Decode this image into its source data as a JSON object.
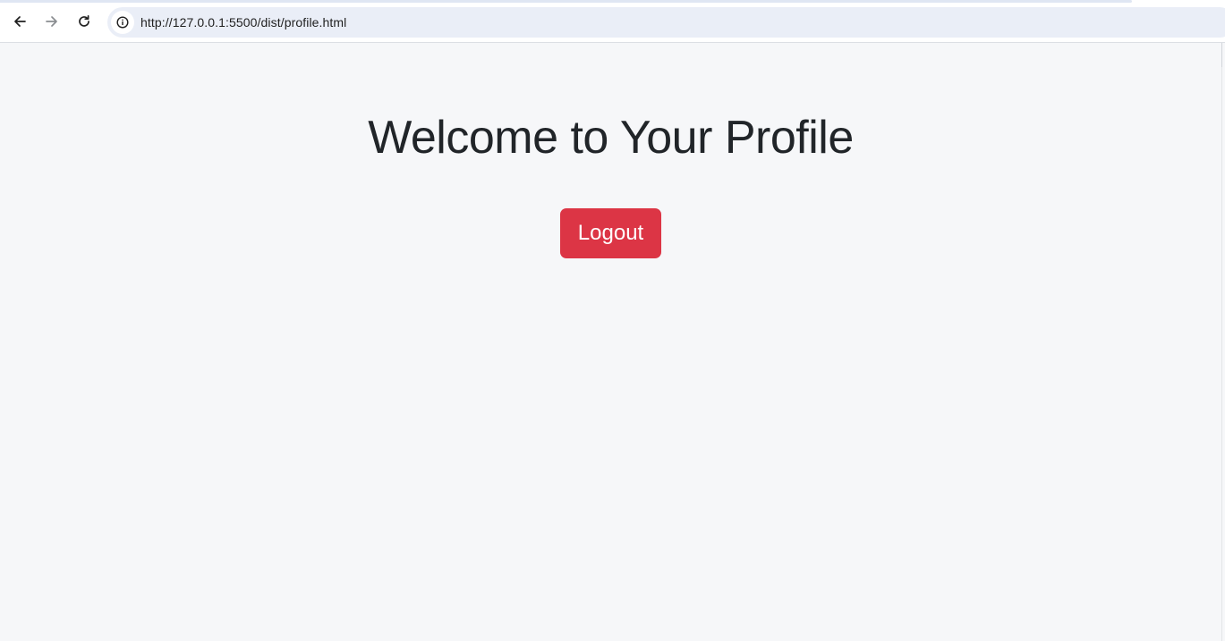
{
  "browser": {
    "url": "http://127.0.0.1:5500/dist/profile.html",
    "icons": {
      "back": "arrow-left-icon",
      "forward": "arrow-right-icon",
      "reload": "reload-icon",
      "site_info": "info-icon"
    }
  },
  "page": {
    "title": "Welcome to Your Profile",
    "logout_label": "Logout",
    "colors": {
      "background": "#f6f7f9",
      "title": "#212529",
      "logout_button": "#dc3545",
      "logout_text": "#ffffff"
    }
  }
}
